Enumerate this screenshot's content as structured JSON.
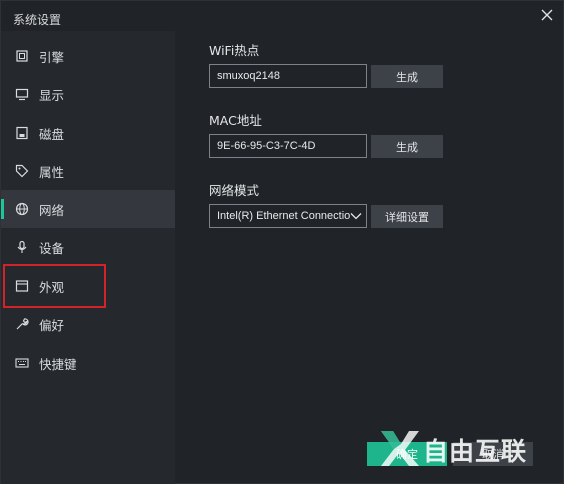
{
  "window": {
    "title": "系统设置"
  },
  "sidebar": {
    "items": [
      {
        "label": "引擎",
        "icon": "cpu-icon"
      },
      {
        "label": "显示",
        "icon": "monitor-icon"
      },
      {
        "label": "磁盘",
        "icon": "disk-icon"
      },
      {
        "label": "属性",
        "icon": "tag-icon"
      },
      {
        "label": "网络",
        "icon": "globe-icon",
        "active": true
      },
      {
        "label": "设备",
        "icon": "microphone-icon"
      },
      {
        "label": "外观",
        "icon": "window-icon"
      },
      {
        "label": "偏好",
        "icon": "wrench-icon"
      },
      {
        "label": "快捷键",
        "icon": "keyboard-icon"
      }
    ]
  },
  "network": {
    "wifi_label": "WiFi热点",
    "wifi_value": "smuxoq2148",
    "wifi_generate": "生成",
    "mac_label": "MAC地址",
    "mac_value": "9E-66-95-C3-7C-4D",
    "mac_generate": "生成",
    "mode_label": "网络模式",
    "mode_value": "Intel(R) Ethernet Connectio",
    "mode_details": "详细设置"
  },
  "footer": {
    "ok": "确定",
    "cancel": "取消"
  },
  "watermark": {
    "text": "自由互联"
  },
  "colors": {
    "accent": "#1fc59a",
    "highlight": "#d2222a"
  }
}
